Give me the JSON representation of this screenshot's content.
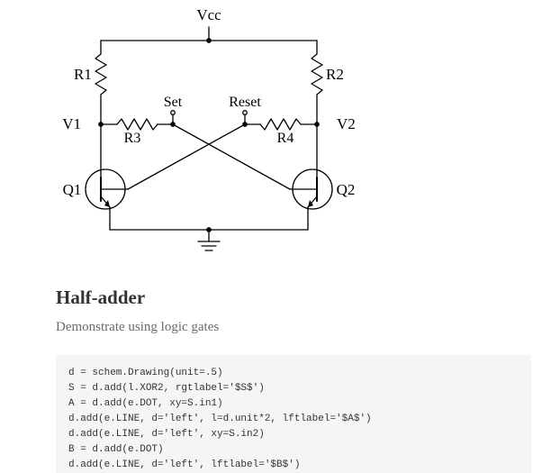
{
  "circuit": {
    "Vcc": "Vcc",
    "R1": "R1",
    "R2": "R2",
    "Set": "Set",
    "Reset": "Reset",
    "V1": "V1",
    "V2": "V2",
    "R3": "R3",
    "R4": "R4",
    "Q1": "Q1",
    "Q2": "Q2"
  },
  "section": {
    "heading": "Half-adder",
    "desc": "Demonstrate using logic gates"
  },
  "code": {
    "l1": "d = schem.Drawing(unit=.5)",
    "l2": "S = d.add(l.XOR2, rgtlabel='$S$')",
    "l3": "A = d.add(e.DOT, xy=S.in1)",
    "l4": "d.add(e.LINE, d='left', l=d.unit*2, lftlabel='$A$')",
    "l5": "d.add(e.LINE, d='left', xy=S.in2)",
    "l6": "B = d.add(e.DOT)",
    "l7": "d.add(e.LINE, d='left', lftlabel='$B$')"
  }
}
